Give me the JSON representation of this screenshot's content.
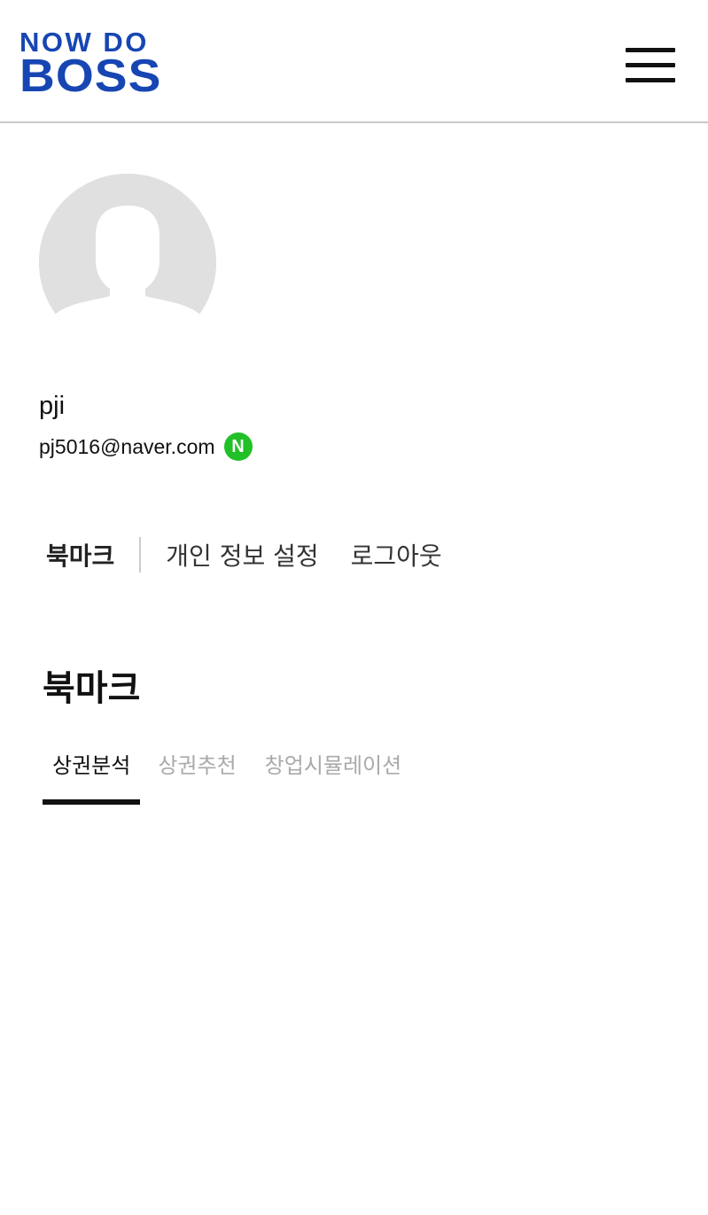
{
  "header": {
    "logo_top": "NOW DO",
    "logo_bottom": "BOSS",
    "logo_color": "#1746b3",
    "menu_icon": "hamburger-menu-icon"
  },
  "profile": {
    "avatar_icon": "default-avatar-icon",
    "username": "pji",
    "email": "pj5016@naver.com",
    "login_provider_badge": "N",
    "login_provider_color": "#21c027"
  },
  "account_menu": {
    "items": [
      {
        "label": "북마크",
        "active": true
      },
      {
        "label": "개인 정보 설정",
        "active": false
      },
      {
        "label": "로그아웃",
        "active": false
      }
    ]
  },
  "bookmarks": {
    "title": "북마크",
    "tabs": [
      {
        "label": "상권분석",
        "active": true
      },
      {
        "label": "상권추천",
        "active": false
      },
      {
        "label": "창업시뮬레이션",
        "active": false
      }
    ]
  }
}
